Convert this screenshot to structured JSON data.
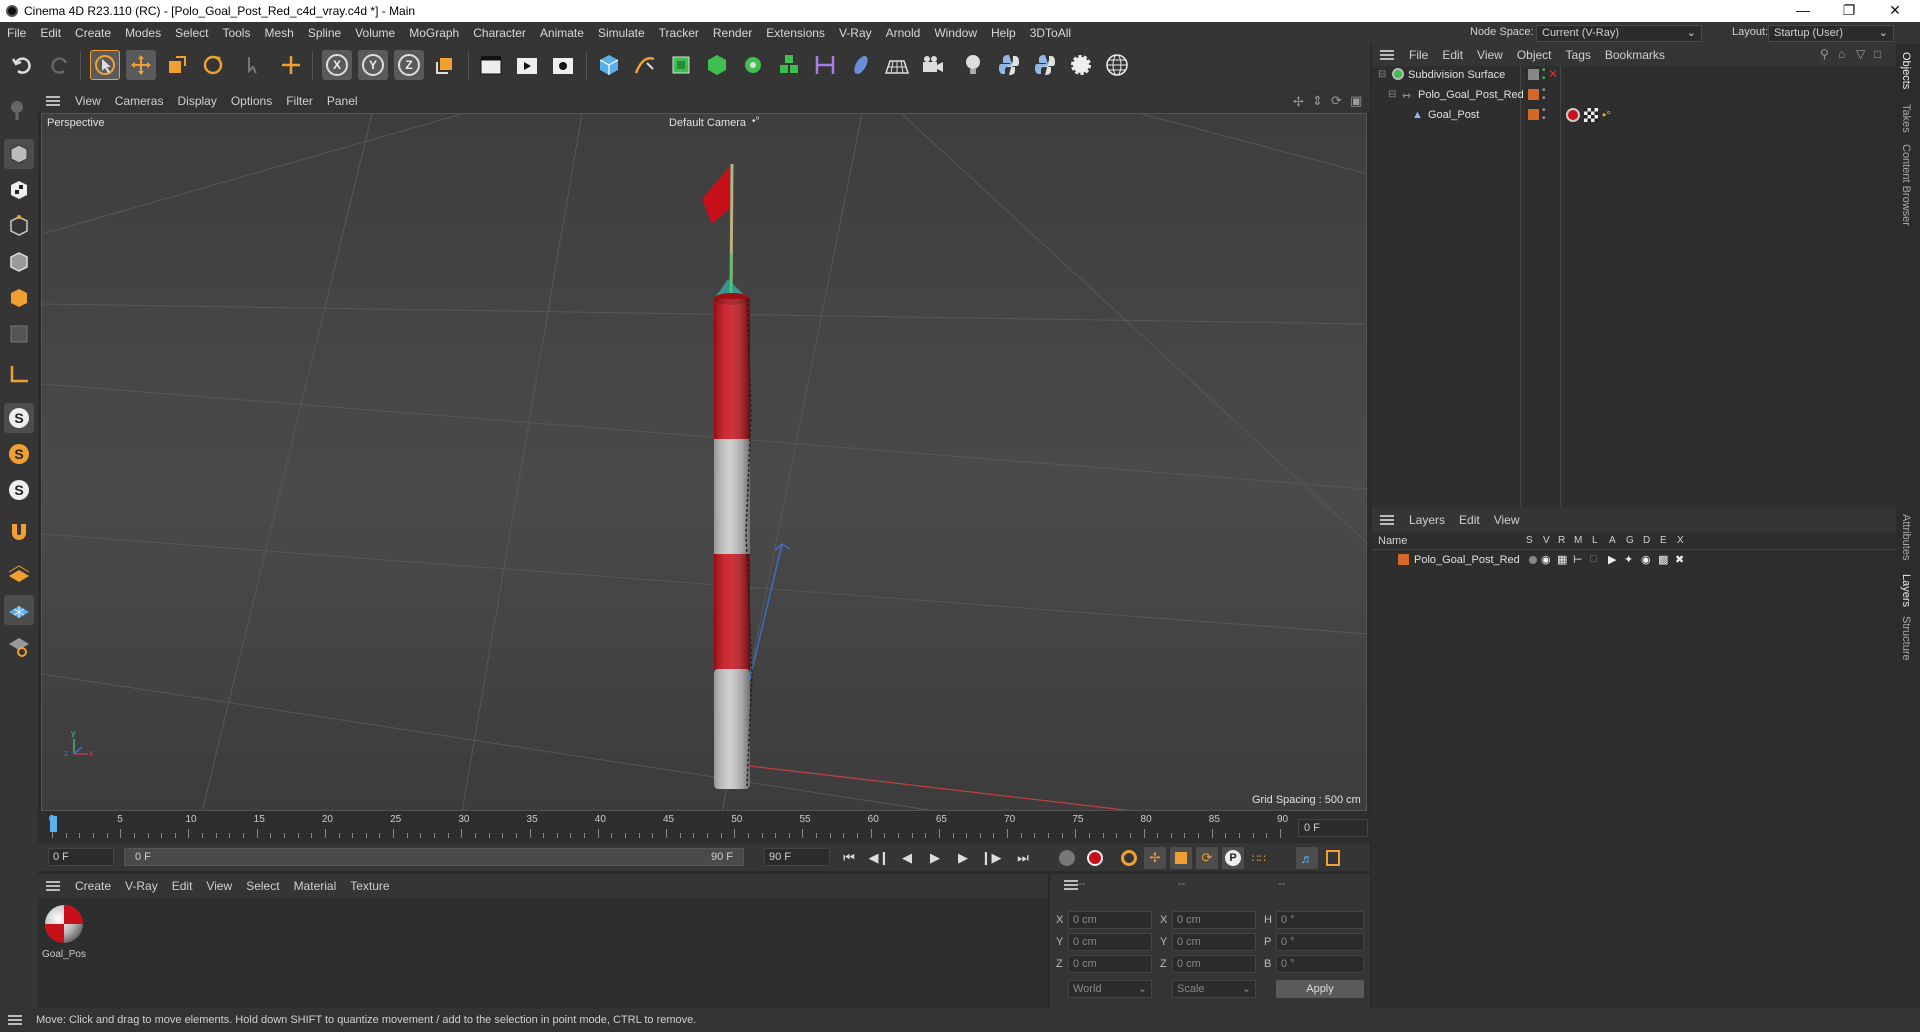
{
  "window": {
    "title": "Cinema 4D R23.110 (RC) - [Polo_Goal_Post_Red_c4d_vray.c4d *] - Main",
    "minimize": "—",
    "restore": "❐",
    "close": "✕"
  },
  "menubar": {
    "items": [
      "File",
      "Edit",
      "Create",
      "Modes",
      "Select",
      "Tools",
      "Mesh",
      "Spline",
      "Volume",
      "MoGraph",
      "Character",
      "Animate",
      "Simulate",
      "Tracker",
      "Render",
      "Extensions",
      "V-Ray",
      "Arnold",
      "Window",
      "Help",
      "3DToAll"
    ],
    "node_space_label": "Node Space:",
    "node_space_value": "Current (V-Ray)",
    "layout_label": "Layout:",
    "layout_value": "Startup (User)"
  },
  "toolbar": {
    "axis_x": "X",
    "axis_y": "Y",
    "axis_z": "Z"
  },
  "viewport_menu": [
    "View",
    "Cameras",
    "Display",
    "Options",
    "Filter",
    "Panel"
  ],
  "viewport": {
    "projection": "Perspective",
    "camera": "Default Camera",
    "grid_spacing": "Grid Spacing : 500 cm",
    "axis_x": "x",
    "axis_y": "y",
    "axis_z": "z"
  },
  "timeline": {
    "ticks": [
      "0",
      "5",
      "10",
      "15",
      "20",
      "25",
      "30",
      "35",
      "40",
      "45",
      "50",
      "55",
      "60",
      "65",
      "70",
      "75",
      "80",
      "85",
      "90"
    ],
    "current_frame_right": "0 F"
  },
  "playbar": {
    "start_frame": "0 F",
    "range_start": "0 F",
    "range_end": "90 F",
    "end_frame": "90 F"
  },
  "material_menu": [
    "Create",
    "V-Ray",
    "Edit",
    "View",
    "Select",
    "Material",
    "Texture"
  ],
  "materials": [
    {
      "name": "Goal_Pos"
    }
  ],
  "coords": {
    "header": [
      "--",
      "--",
      "--"
    ],
    "rows": [
      {
        "l1": "X",
        "v1": "0 cm",
        "l2": "X",
        "v2": "0 cm",
        "l3": "H",
        "v3": "0 °"
      },
      {
        "l1": "Y",
        "v1": "0 cm",
        "l2": "Y",
        "v2": "0 cm",
        "l3": "P",
        "v3": "0 °"
      },
      {
        "l1": "Z",
        "v1": "0 cm",
        "l2": "Z",
        "v2": "0 cm",
        "l3": "B",
        "v3": "0 °"
      }
    ],
    "world": "World",
    "scale": "Scale",
    "apply": "Apply"
  },
  "status": "Move: Click and drag to move elements. Hold down SHIFT to quantize movement / add to the selection in point mode, CTRL to remove.",
  "objects_menu": [
    "File",
    "Edit",
    "View",
    "Object",
    "Tags",
    "Bookmarks"
  ],
  "objects": [
    {
      "name": "Subdivision Surface",
      "level": 0
    },
    {
      "name": "Polo_Goal_Post_Red",
      "level": 1
    },
    {
      "name": "Goal_Post",
      "level": 2
    }
  ],
  "layers_menu": [
    "Layers",
    "Edit",
    "View"
  ],
  "layers_header": {
    "name": "Name",
    "cols": [
      "S",
      "V",
      "R",
      "M",
      "L",
      "A",
      "G",
      "D",
      "E",
      "X"
    ]
  },
  "layers": [
    {
      "name": "Polo_Goal_Post_Red"
    }
  ],
  "side_tabs": [
    "Objects",
    "Takes",
    "Content Browser",
    "Attributes",
    "Layers",
    "Structure"
  ],
  "colors": {
    "accent": "#f0a030",
    "layer": "#d4682a",
    "flag_red": "#c8101a"
  }
}
